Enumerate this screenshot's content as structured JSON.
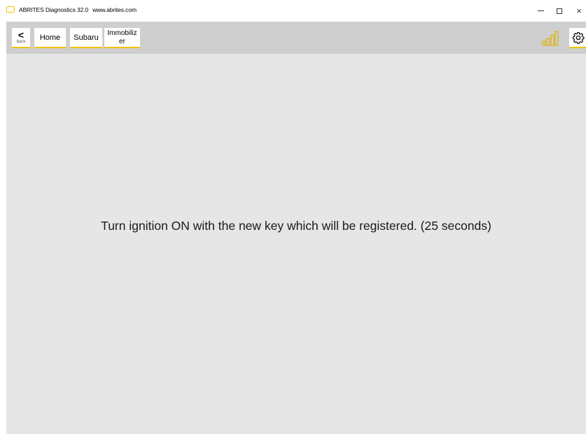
{
  "window": {
    "title": "ABRITES Diagnostics 32.0",
    "url": "www.abrites.com",
    "minimize_icon": "minimize-icon",
    "maximize_icon": "maximize-icon",
    "close_glyph": "×"
  },
  "toolbar": {
    "back_chevron": "<",
    "back_label": "back",
    "breadcrumb": {
      "home_label": "Home",
      "subaru_label": "Subaru",
      "immobilizer_line1": "Immobiliz",
      "immobilizer_line2": "er"
    },
    "signal_icon": "signal-strength-icon",
    "settings_icon": "gear-icon"
  },
  "main": {
    "message": "Turn ignition ON with the new key which will be registered. (25 seconds)"
  },
  "colors": {
    "accent": "#f2c200",
    "toolbar_bg": "#cfcfcf",
    "content_bg": "#e6e6e6"
  }
}
